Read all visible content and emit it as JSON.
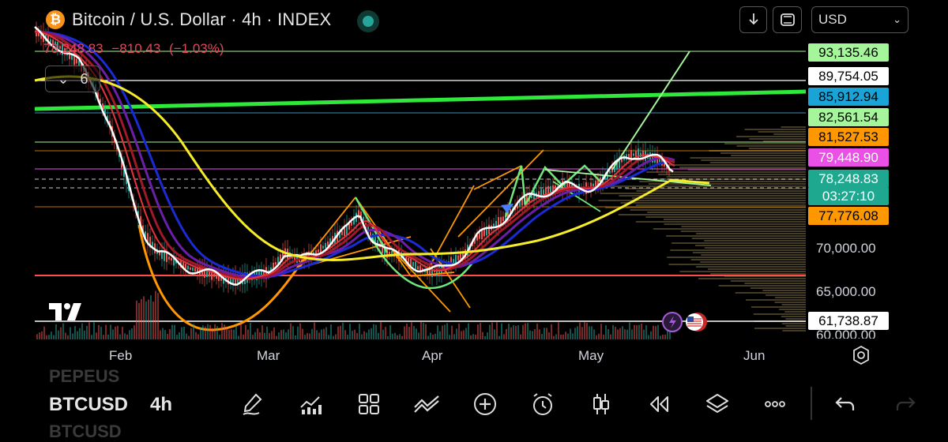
{
  "header": {
    "logo_glyph": "₿",
    "title": "Bitcoin / U.S. Dollar · 4h · INDEX",
    "currency": "USD",
    "download_icon": "download-icon",
    "fullscreen_icon": "fullscreen-icon"
  },
  "ohlc": {
    "price": "78,248.83",
    "change": "−810.43",
    "change_pct": "(−1.03%)"
  },
  "indicators": {
    "count": "6"
  },
  "price_labels": [
    {
      "text": "93,135.46",
      "bg": "#a5f59a",
      "fg": "#000000"
    },
    {
      "text": "89,754.05",
      "bg": "#ffffff",
      "fg": "#000000"
    },
    {
      "text": "85,912.94",
      "bg": "#1aa3d6",
      "fg": "#000000"
    },
    {
      "text": "82,561.54",
      "bg": "#a5f59a",
      "fg": "#000000"
    },
    {
      "text": "81,527.53",
      "bg": "#ff9800",
      "fg": "#000000"
    },
    {
      "text": "79,448.90",
      "bg": "#ea4fe6",
      "fg": "#ffffff"
    },
    {
      "text": "78,248.83",
      "bg": "#1ea88f",
      "fg": "#ffffff"
    },
    {
      "text": "03:27:10",
      "bg": "#1ea88f",
      "fg": "#ffffff"
    },
    {
      "text": "77,776.08",
      "bg": "#ff9800",
      "fg": "#000000"
    },
    {
      "text": "61,738.87",
      "bg": "#ffffff",
      "fg": "#000000"
    }
  ],
  "axis_labels": [
    "70,000.00",
    "65,000.00",
    "60,000.00"
  ],
  "months": [
    "Feb",
    "Mar",
    "Apr",
    "May",
    "Jun"
  ],
  "toolbar": {
    "ghost_top": "PEPEUS",
    "symbol": "BTCUSD",
    "ghost_bottom": "BTCUSD",
    "interval": "4h",
    "icons": [
      "brush-icon",
      "indicators-icon",
      "grid-icon",
      "compare-icon",
      "add-icon",
      "alarm-icon",
      "candles-icon",
      "replay-icon",
      "layers-icon",
      "more-icon",
      "undo-icon",
      "redo-icon"
    ]
  },
  "colors": {
    "up": "#26a69a",
    "down": "#ef5350",
    "accent": "#ff9800"
  }
}
